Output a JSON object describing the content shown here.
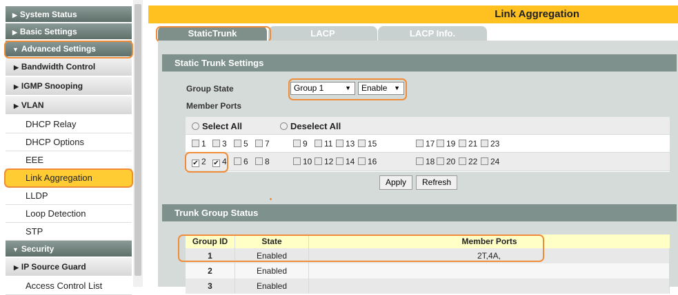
{
  "sidebar": {
    "headers": [
      {
        "label": "System Status",
        "expanded": false
      },
      {
        "label": "Basic Settings",
        "expanded": false
      },
      {
        "label": "Advanced Settings",
        "expanded": true
      },
      {
        "label": "Security",
        "expanded": true
      }
    ],
    "subheaders": [
      "Bandwidth Control",
      "IGMP Snooping",
      "VLAN",
      "IP Source Guard"
    ],
    "items": [
      "DHCP Relay",
      "DHCP Options",
      "EEE",
      "Link Aggregation",
      "LLDP",
      "Loop Detection",
      "STP",
      "Access Control List"
    ],
    "selected": "Link Aggregation"
  },
  "page": {
    "title": "Link Aggregation",
    "tabs": [
      "StaticTrunk",
      "LACP",
      "LACP Info."
    ],
    "active_tab": "StaticTrunk"
  },
  "static_trunk": {
    "section_title": "Static Trunk Settings",
    "group_state_label": "Group State",
    "group_value": "Group 1",
    "state_value": "Enable",
    "member_ports_label": "Member Ports",
    "select_all": "Select All",
    "deselect_all": "Deselect All",
    "odd_ports": [
      "1",
      "3",
      "5",
      "7",
      "9",
      "11",
      "13",
      "15",
      "17",
      "19",
      "21",
      "23"
    ],
    "even_ports": [
      "2",
      "4",
      "6",
      "8",
      "10",
      "12",
      "14",
      "16",
      "18",
      "20",
      "22",
      "24"
    ],
    "checked_ports": [
      "2",
      "4"
    ],
    "apply_label": "Apply",
    "refresh_label": "Refresh"
  },
  "trunk_status": {
    "section_title": "Trunk Group Status",
    "headers": [
      "Group ID",
      "State",
      "Member Ports"
    ],
    "rows": [
      {
        "group": "1",
        "state": "Enabled",
        "members": "2T,4A,"
      },
      {
        "group": "2",
        "state": "Enabled",
        "members": ""
      },
      {
        "group": "3",
        "state": "Enabled",
        "members": ""
      }
    ]
  },
  "colors": {
    "accent": "#ffc11f",
    "highlight": "#f08c37",
    "header": "#7f918c"
  }
}
